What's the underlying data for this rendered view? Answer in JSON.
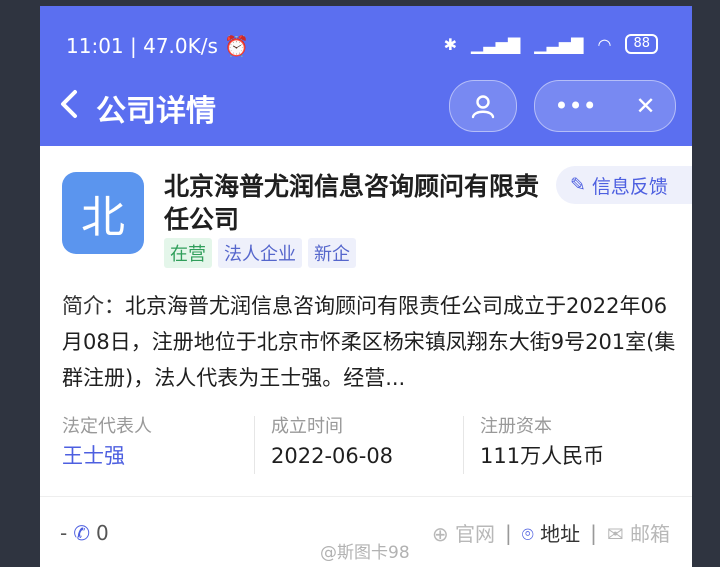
{
  "status_bar": {
    "time": "11:01",
    "network_speed": "47.0K/s",
    "battery": "88"
  },
  "nav": {
    "back_icon": "chevron-left-icon",
    "title": "公司详情",
    "more_icon": "•••",
    "close_icon": "✕"
  },
  "company": {
    "logo_char": "北",
    "name": "北京海普尤润信息咨询顾问有限责任公司",
    "feedback_label": "信息反馈",
    "tags": [
      "在营",
      "法人企业",
      "新企"
    ],
    "intro_label": "简介：",
    "intro_text": "北京海普尤润信息咨询顾问有限责任公司成立于2022年06月08日，注册地位于北京市怀柔区杨宋镇凤翔东大街9号201室(集群注册)，法人代表为王士强。经营..."
  },
  "info": {
    "legal_rep_label": "法定代表人",
    "legal_rep_value": "王士强",
    "founded_label": "成立时间",
    "founded_value": "2022-06-08",
    "capital_label": "注册资本",
    "capital_value": "111万人民币"
  },
  "bottom": {
    "dash": "-",
    "phone_count": "0",
    "website_label": "官网",
    "address_label": "地址",
    "email_label": "邮箱"
  },
  "watermark": "@斯图卡98",
  "colors": {
    "header_blue": "#5b6ff0",
    "logo_blue": "#5b95ee",
    "accent": "#4d5fe0",
    "status_green": "#2f9e5a"
  }
}
